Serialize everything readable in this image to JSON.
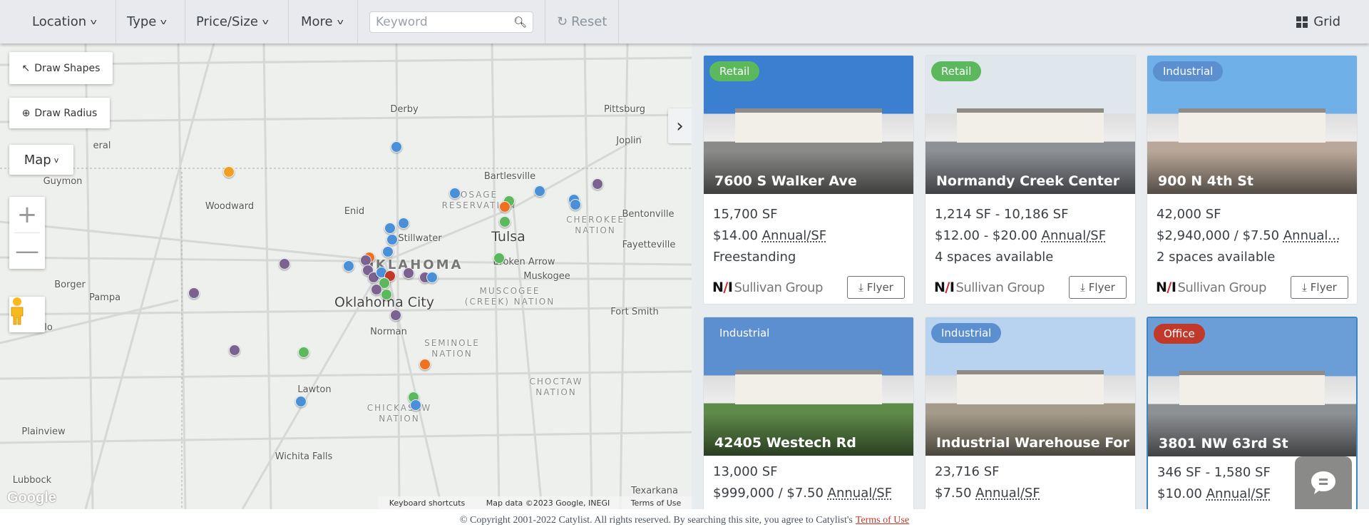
{
  "header": {
    "filters": [
      {
        "label": "Location"
      },
      {
        "label": "Type"
      },
      {
        "label": "Price/Size"
      },
      {
        "label": "More"
      }
    ],
    "keyword_placeholder": "Keyword",
    "keyword_value": "",
    "reset_label": "Reset",
    "grid_label": "Grid"
  },
  "map": {
    "draw_shapes": "Draw Shapes",
    "draw_radius": "Draw Radius",
    "map_type": "Map",
    "labels": [
      "Derby",
      "Pittsburg",
      "Joplin",
      "Bartlesville",
      "eral",
      "Guymon",
      "Woodward",
      "Enid",
      "OSAGE\nRESERVATION",
      "Bentonville",
      "CHEROKEE\nNATION",
      "Fayetteville",
      "Stillwater",
      "Tulsa",
      "OKLAHOMA",
      "Broken Arrow",
      "Muskogee",
      "Borger",
      "Pampa",
      "MUSCOGEE\n(CREEK) NATION",
      "Oklahoma City",
      "Amarillo",
      "Fort Smith",
      "SEMINOLE\nNATION",
      "Norman",
      "CHOCTAW\nNATION",
      "Lawton",
      "CHICKASAW\nNATION",
      "Plainview",
      "Wichita Falls",
      "Texarkana",
      "Lubbock"
    ],
    "google_logo": "Google",
    "attribution": {
      "shortcuts": "Keyboard shortcuts",
      "data": "Map data ©2023 Google, INEGI",
      "terms": "Terms of Use"
    },
    "category_colors": {
      "Retail": "#5cb85c",
      "Industrial": "#4a90d9",
      "Office": "#c0392b",
      "Land": "#f0a020",
      "Multifamily": "#7a6390",
      "Other": "#f07020"
    }
  },
  "listings": [
    {
      "type": "Retail",
      "type_color": "#5cb85c",
      "title": "7600 S Walker Ave",
      "size": "15,700 SF",
      "price": "$14.00",
      "price_unit": "Annual/SF",
      "detail": "Freestanding",
      "broker": "Sullivan Group",
      "flyer": "Flyer"
    },
    {
      "type": "Retail",
      "type_color": "#5cb85c",
      "title": "Normandy Creek Center",
      "size": "1,214 SF - 10,186 SF",
      "price": "$12.00 - $20.00",
      "price_unit": "Annual/SF",
      "detail": "4 spaces available",
      "broker": "Sullivan Group",
      "flyer": "Flyer"
    },
    {
      "type": "Industrial",
      "type_color": "#5b8fd0",
      "title": "900 N 4th St",
      "size": "42,000 SF",
      "price": "$2,940,000 / $7.50",
      "price_unit": "Annual...",
      "detail": "2 spaces available",
      "broker": "Sullivan Group",
      "flyer": "Flyer"
    },
    {
      "type": "Industrial",
      "type_color": "#5b8fd0",
      "title": "42405 Westech Rd",
      "size": "13,000 SF",
      "price": "$999,000 / $7.50",
      "price_unit": "Annual/SF",
      "detail": "",
      "broker": "",
      "flyer": ""
    },
    {
      "type": "Industrial",
      "type_color": "#5b8fd0",
      "title": "Industrial Warehouse For ...",
      "size": "23,716 SF",
      "price": "$7.50",
      "price_unit": "Annual/SF",
      "detail": "",
      "broker": "",
      "flyer": ""
    },
    {
      "type": "Office",
      "type_color": "#c0392b",
      "title": "3801 NW 63rd St",
      "size": "346 SF - 1,580 SF",
      "price": "$10.00",
      "price_unit": "Annual/SF",
      "detail": "",
      "broker": "",
      "flyer": ""
    }
  ],
  "footer": {
    "text": "© Copyright 2001-2022 Catylist. All rights reserved. By searching this site, you agree to Catylist's",
    "link": "Terms of Use"
  }
}
